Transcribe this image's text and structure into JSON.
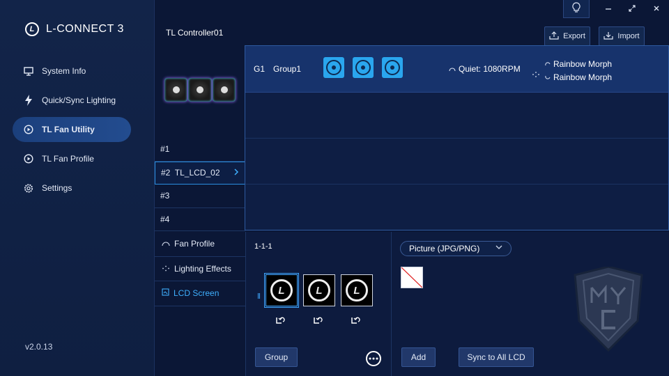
{
  "app": {
    "name": "L-CONNECT 3",
    "logo_letter": "L",
    "version": "v2.0.13"
  },
  "nav": [
    {
      "label": "System Info",
      "icon": "monitor-icon"
    },
    {
      "label": "Quick/Sync Lighting",
      "icon": "lightning-icon"
    },
    {
      "label": "TL Fan Utility",
      "icon": "fan-utility-icon",
      "active": true
    },
    {
      "label": "TL Fan Profile",
      "icon": "fan-profile-icon"
    },
    {
      "label": "Settings",
      "icon": "gear-icon"
    }
  ],
  "controller": {
    "title": "TL Controller01",
    "export_label": "Export",
    "import_label": "Import"
  },
  "ports": [
    {
      "label": "#1"
    },
    {
      "label": "#2  TL_LCD_02",
      "active": true
    },
    {
      "label": "#3"
    },
    {
      "label": "#4"
    }
  ],
  "group": {
    "id": "G1",
    "name": "Group1",
    "fan_count": 3,
    "speed": "Quiet: 1080RPM",
    "lighting": [
      "Rainbow Morph",
      "Rainbow Morph"
    ]
  },
  "subtabs": [
    {
      "label": "Fan Profile",
      "icon": "gauge-icon"
    },
    {
      "label": "Lighting Effects",
      "icon": "sparkle-icon"
    },
    {
      "label": "LCD Screen",
      "icon": "lcd-icon",
      "active": true
    }
  ],
  "lcd": {
    "id": "1-1-1",
    "tiles": [
      {
        "logo": "L"
      },
      {
        "logo": "L"
      },
      {
        "logo": "L"
      }
    ],
    "group_button": "Group"
  },
  "media": {
    "type_select": "Picture (JPG/PNG)",
    "add_button": "Add",
    "sync_button": "Sync to All LCD"
  },
  "colors": {
    "accent": "#3fb0ff",
    "background": "#0b1736",
    "fan_tile": "#2aa6ee"
  }
}
